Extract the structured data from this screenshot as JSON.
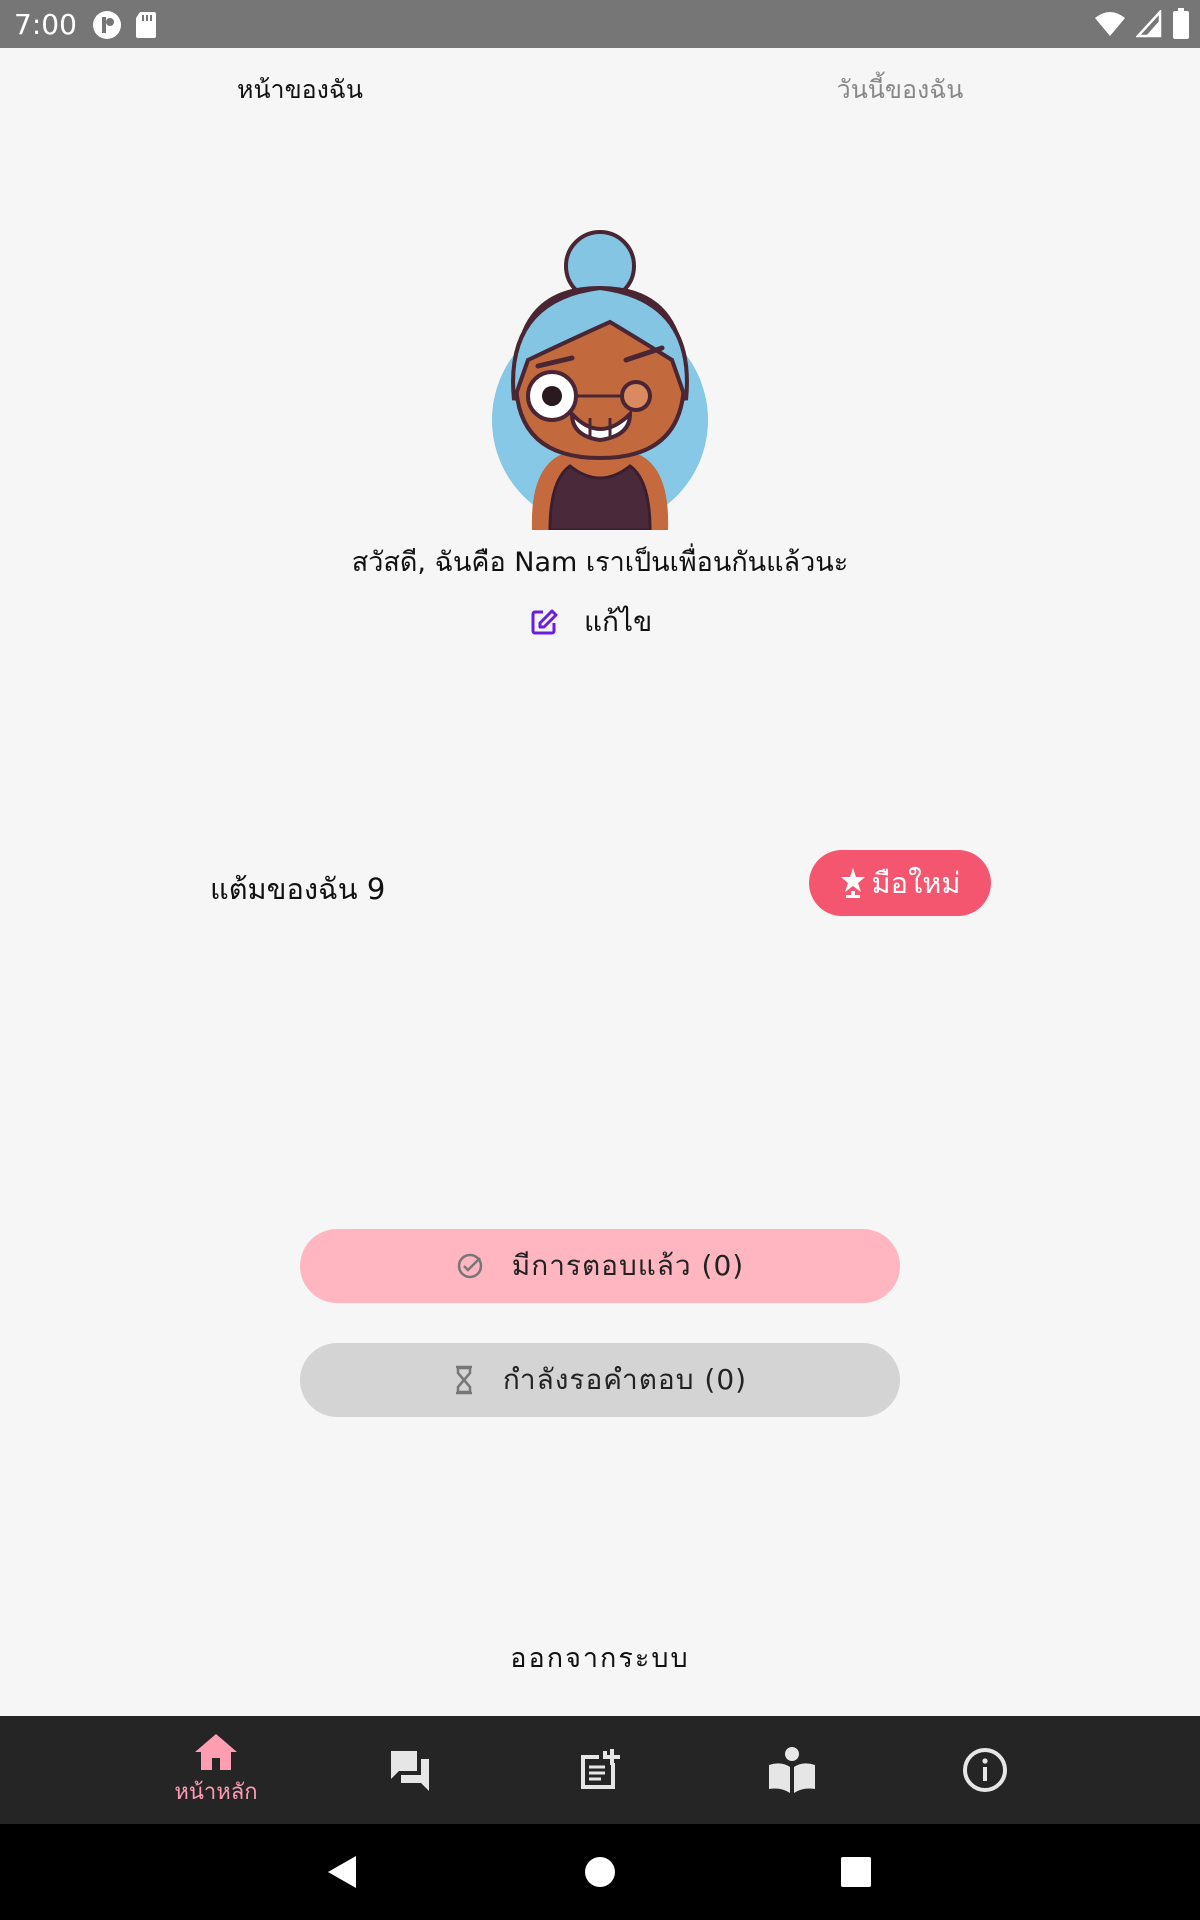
{
  "status_bar": {
    "time": "7:00"
  },
  "top_tabs": {
    "my_page": "หน้าของฉัน",
    "my_day": "วันนี้ของฉัน"
  },
  "profile": {
    "greeting": "สวัสดี, ฉันคือ Nam เราเป็นเพื่อนกันแล้วนะ",
    "edit_label": "แก้ไข"
  },
  "points": {
    "label": "แต้มของฉัน 9",
    "badge_label": "มือใหม่",
    "badge_color": "#f4566f"
  },
  "questions": {
    "answered_label": "มีการตอบแล้ว (0)",
    "waiting_label": "กำลังรอคำตอบ (0)"
  },
  "logout_label": "ออกจากระบบ",
  "bottom_nav": {
    "home_label": "หน้าหลัก",
    "active_color": "#ff9db2"
  },
  "icons": [
    "home-icon",
    "chat-icon",
    "post-add-icon",
    "book-reader-icon",
    "info-icon"
  ]
}
